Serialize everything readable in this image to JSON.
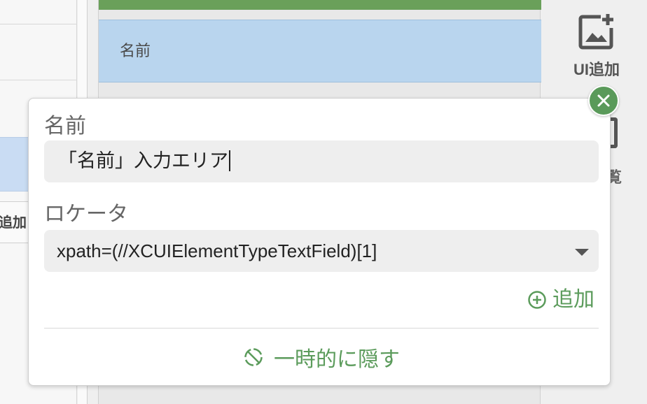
{
  "background": {
    "left_add_label": "追加",
    "selected_row_label": "名前",
    "right_rail": {
      "ui_add_label": "UI追加",
      "list_label_fragment": "覧"
    }
  },
  "popup": {
    "name_label": "名前",
    "name_value": "「名前」入力エリア",
    "locator_label": "ロケータ",
    "locator_value": "xpath=(//XCUIElementTypeTextField)[1]",
    "add_label": "追加",
    "hide_label": "一時的に隠す"
  },
  "colors": {
    "accent_green": "#5b9b5b",
    "header_green": "#6aa05a",
    "selection_blue": "#b9d5ee"
  },
  "icons": {
    "close": "close-icon",
    "add": "plus-circle-icon",
    "hide": "hidden-icon",
    "ui_add": "image-add-icon"
  }
}
